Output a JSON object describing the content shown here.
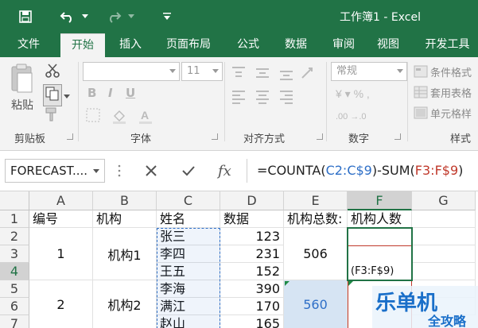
{
  "titlebar": {
    "title": "工作簿1 - Excel",
    "icons": [
      "save-icon",
      "undo-icon",
      "redo-icon",
      "customize-qat-icon"
    ]
  },
  "tabs": [
    "文件",
    "开始",
    "插入",
    "页面布局",
    "公式",
    "数据",
    "审阅",
    "视图",
    "开发工具"
  ],
  "active_tab": "开始",
  "ribbon": {
    "clipboard": {
      "label": "剪贴板",
      "paste": "粘贴"
    },
    "font": {
      "label": "字体",
      "font_size": "11"
    },
    "alignment": {
      "label": "对齐方式"
    },
    "number": {
      "label": "数字",
      "format": "常规"
    },
    "styles": {
      "label": "样式",
      "conditional": "条件格式",
      "table": "套用表格",
      "cell": "单元格样"
    }
  },
  "formula_bar": {
    "name_box": "FORECAST....",
    "formula_prefix": "=COUNTA(",
    "ref1": "C2:C$9",
    "formula_mid": ")-SUM(",
    "ref2": "F3:F$9",
    "formula_suffix": ")"
  },
  "grid": {
    "columns": [
      "A",
      "B",
      "C",
      "D",
      "E",
      "F",
      "G"
    ],
    "rows": [
      "1",
      "2",
      "3",
      "4",
      "5",
      "6",
      "7"
    ],
    "header_row": [
      "编号",
      "机构",
      "姓名",
      "数据",
      "机构总数:",
      "机构人数",
      ""
    ],
    "names": [
      "张三",
      "李四",
      "王五",
      "李海",
      "满江",
      "赵山"
    ],
    "data": [
      "123",
      "231",
      "152",
      "390",
      "170",
      "165"
    ],
    "group1": {
      "id": "1",
      "org": "机构1",
      "total": "506"
    },
    "group2": {
      "id": "2",
      "org": "机构2",
      "total": "560"
    },
    "f4_text": "(F3:F$9)"
  },
  "watermark": {
    "line1": "乐单机",
    "line2": "全攻略"
  },
  "colors": {
    "excel_green": "#217346",
    "ref_blue": "#2e6fc7",
    "ref_red": "#c0392b"
  }
}
